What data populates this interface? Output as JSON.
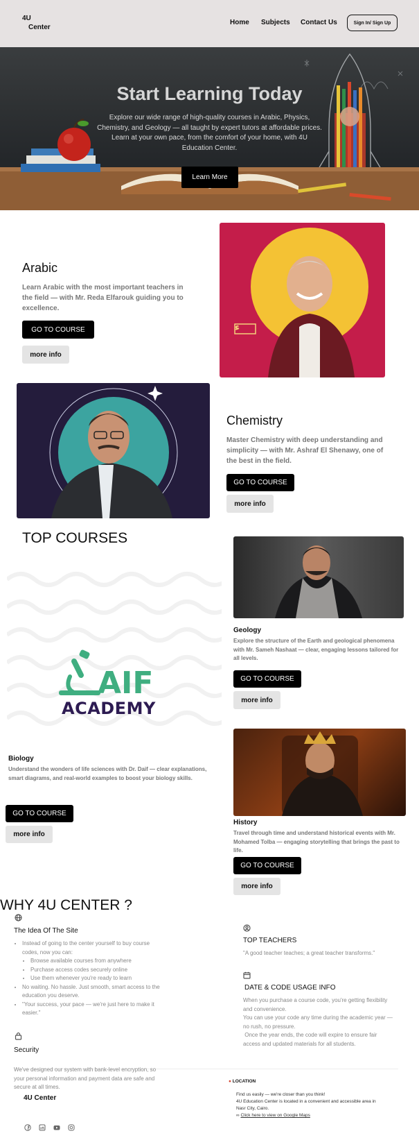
{
  "header": {
    "logo_line1": "4U",
    "logo_line2": "Center",
    "nav": [
      "Home",
      "Subjects",
      "Contact Us"
    ],
    "signin_label": "Sign In/ Sign Up"
  },
  "hero": {
    "title": "Start Learning Today",
    "text": "Explore our wide range of high-quality courses in Arabic, Physics, Chemistry, and Geology — all taught by expert tutors at affordable prices. Learn at your own pace, from the comfort of your home, with 4U Education Center.",
    "button": "Learn More"
  },
  "arabic": {
    "title": "Arabic",
    "desc": "Learn Arabic with the most important teachers in the field — with Mr. Reda Elfarouk guiding you to excellence.",
    "go": "GO TO COURSE",
    "more": "more info"
  },
  "chemistry": {
    "title": "Chemistry",
    "desc": "Master Chemistry with deep understanding and simplicity — with Mr. Ashraf El Shenawy, one of the best in the field.",
    "go": "GO TO COURSE",
    "more": "more info"
  },
  "top_courses": {
    "title": "TOP COURSES",
    "daif_logo": "DAIF ACADEMY",
    "biology": {
      "title": "Biology",
      "desc": "Understand the wonders of life sciences with Dr. Daif — clear explanations, smart diagrams, and real-world examples to boost your biology skills.",
      "go": "GO TO COURSE",
      "more": "more info"
    },
    "geology": {
      "title": "Geology",
      "desc": "Explore the structure of the Earth and geological phenomena with Mr. Sameh Nashaat — clear, engaging lessons tailored for all levels.",
      "go": "GO TO COURSE",
      "more": "more info"
    },
    "history": {
      "title": "History",
      "desc": "Travel through time and understand historical events with Mr. Mohamed Tolba — engaging storytelling that brings the past to life.",
      "go": "GO TO COURSE",
      "more": "more info"
    }
  },
  "why": {
    "title": "WHY 4U CENTER ?",
    "idea": {
      "title": "The Idea Of The Site",
      "item1": "Instead of going to the center yourself to buy course codes, now you can:",
      "sub": [
        "Browse available courses from anywhere",
        "Purchase access codes securely online",
        "Use them whenever you're ready to learn"
      ],
      "item2": "No waiting. No hassle. Just smooth, smart access to the education you deserve.",
      "item3": "\"Your success, your pace — we're just here to make it easier.\""
    },
    "teachers": {
      "title": "TOP TEACHERS",
      "text": "\"A good teacher teaches; a great teacher transforms.\""
    },
    "date_code": {
      "title": "DATE & CODE USAGE INFO",
      "p1": "When you purchase a course code, you're getting flexibility and convenience.",
      "p2": "You can use your code any time during the academic year — no rush, no pressure.",
      "p3": " Once the year ends, the code will expire to ensure fair access and updated materials for all students."
    },
    "security": {
      "title": "Security",
      "text": "We've designed our system with bank-level encryption, so your personal information and payment data are safe and secure at all times."
    }
  },
  "footer": {
    "brand": "4U Center",
    "location_title": "LOCATION",
    "loc1": "Find us easily — we're closer than you think!",
    "loc2": "4U Education Center is located in a convenient and accessible area in Nasr City, Cairo.",
    "map_link": "Click here to view on Google Maps",
    "socials": [
      "facebook-icon",
      "linkedin-icon",
      "youtube-icon",
      "instagram-icon"
    ]
  },
  "colors": {
    "header_bg": "#e6e2e2",
    "button_black": "#000000",
    "button_grey": "#e4e4e4",
    "daif_green": "#3fae80",
    "daif_purple": "#2d1b52",
    "arabic_bg": "#c41d4a",
    "arabic_circle": "#f4c234"
  }
}
